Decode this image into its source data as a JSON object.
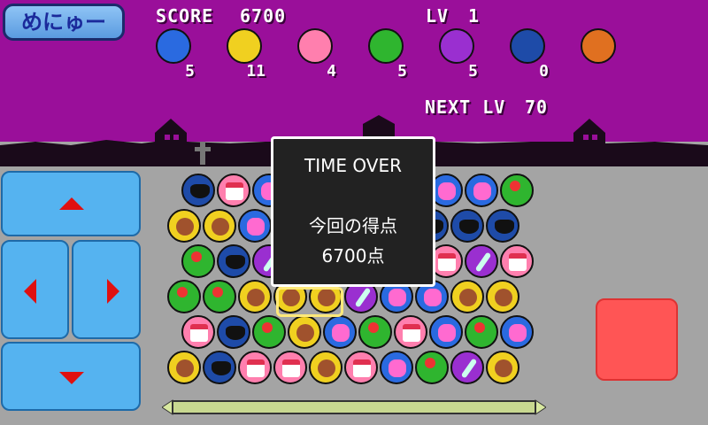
{
  "menu": {
    "label": "めにゅー"
  },
  "hud": {
    "score_label": "SCORE",
    "score_value": "6700",
    "level_label": "LV",
    "level_value": "1",
    "next_label": "NEXT LV",
    "next_value": "70"
  },
  "items": [
    {
      "name": "candy-blue-icon",
      "count": "5",
      "color": "#2a6ae0"
    },
    {
      "name": "cookie-yellow-icon",
      "count": "11",
      "color": "#f0d020"
    },
    {
      "name": "cake-pink-icon",
      "count": "4",
      "color": "#ff7fae"
    },
    {
      "name": "lollipop-green-icon",
      "count": "5",
      "color": "#2fb52f"
    },
    {
      "name": "candycane-purple-icon",
      "count": "5",
      "color": "#9a2fd0"
    },
    {
      "name": "bat-navy-icon",
      "count": "0",
      "color": "#1e4ba8"
    },
    {
      "name": "pumpkin-icon",
      "count": "",
      "color": "#e07020"
    }
  ],
  "dialog": {
    "title": "TIME OVER",
    "label": "今回の得点",
    "score": "6700点"
  },
  "board_rows": [
    [
      "navy",
      "pink",
      "blue",
      "",
      "",
      "",
      "",
      "blue",
      "blue",
      "green"
    ],
    [
      "yellow",
      "yellow",
      "blue",
      "",
      "",
      "",
      "",
      "navy",
      "navy",
      "navy"
    ],
    [
      "green",
      "navy",
      "purple",
      "",
      "",
      "",
      "",
      "pink",
      "purple",
      "pink"
    ],
    [
      "green",
      "green",
      "yellow",
      "yellow",
      "yellow",
      "purple",
      "blue",
      "blue",
      "yellow",
      "yellow"
    ],
    [
      "pink",
      "navy",
      "green",
      "yellow",
      "blue",
      "green",
      "pink",
      "blue",
      "green",
      "blue"
    ],
    [
      "yellow",
      "navy",
      "pink",
      "pink",
      "yellow",
      "pink",
      "blue",
      "green",
      "purple",
      "yellow"
    ]
  ],
  "colors": {
    "sky": "#9a0f9a",
    "ground": "#a4a4a4",
    "pad": "#55b3f0",
    "action": "#ff5555"
  }
}
